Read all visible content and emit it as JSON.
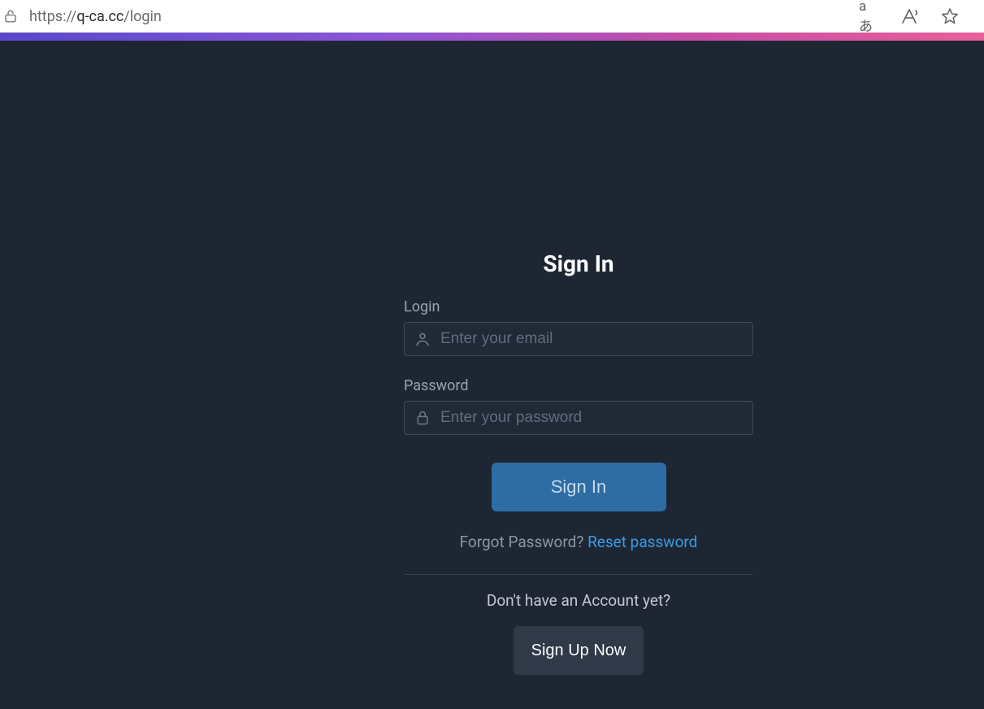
{
  "browser": {
    "url_scheme": "https://",
    "url_host": "q-ca.cc",
    "url_path": "/login",
    "translate_icon": "aあ"
  },
  "page": {
    "title": "Sign In",
    "login_label": "Login",
    "login_placeholder": "Enter your email",
    "password_label": "Password",
    "password_placeholder": "Enter your password",
    "signin_button": "Sign In",
    "forgot_prompt": "Forgot Password? ",
    "reset_link": "Reset password",
    "no_account_prompt": "Don't have an Account yet?",
    "signup_button": "Sign Up Now"
  },
  "colors": {
    "page_bg": "#1e2633",
    "accent": "#2d6da3",
    "link": "#3a9be8"
  }
}
